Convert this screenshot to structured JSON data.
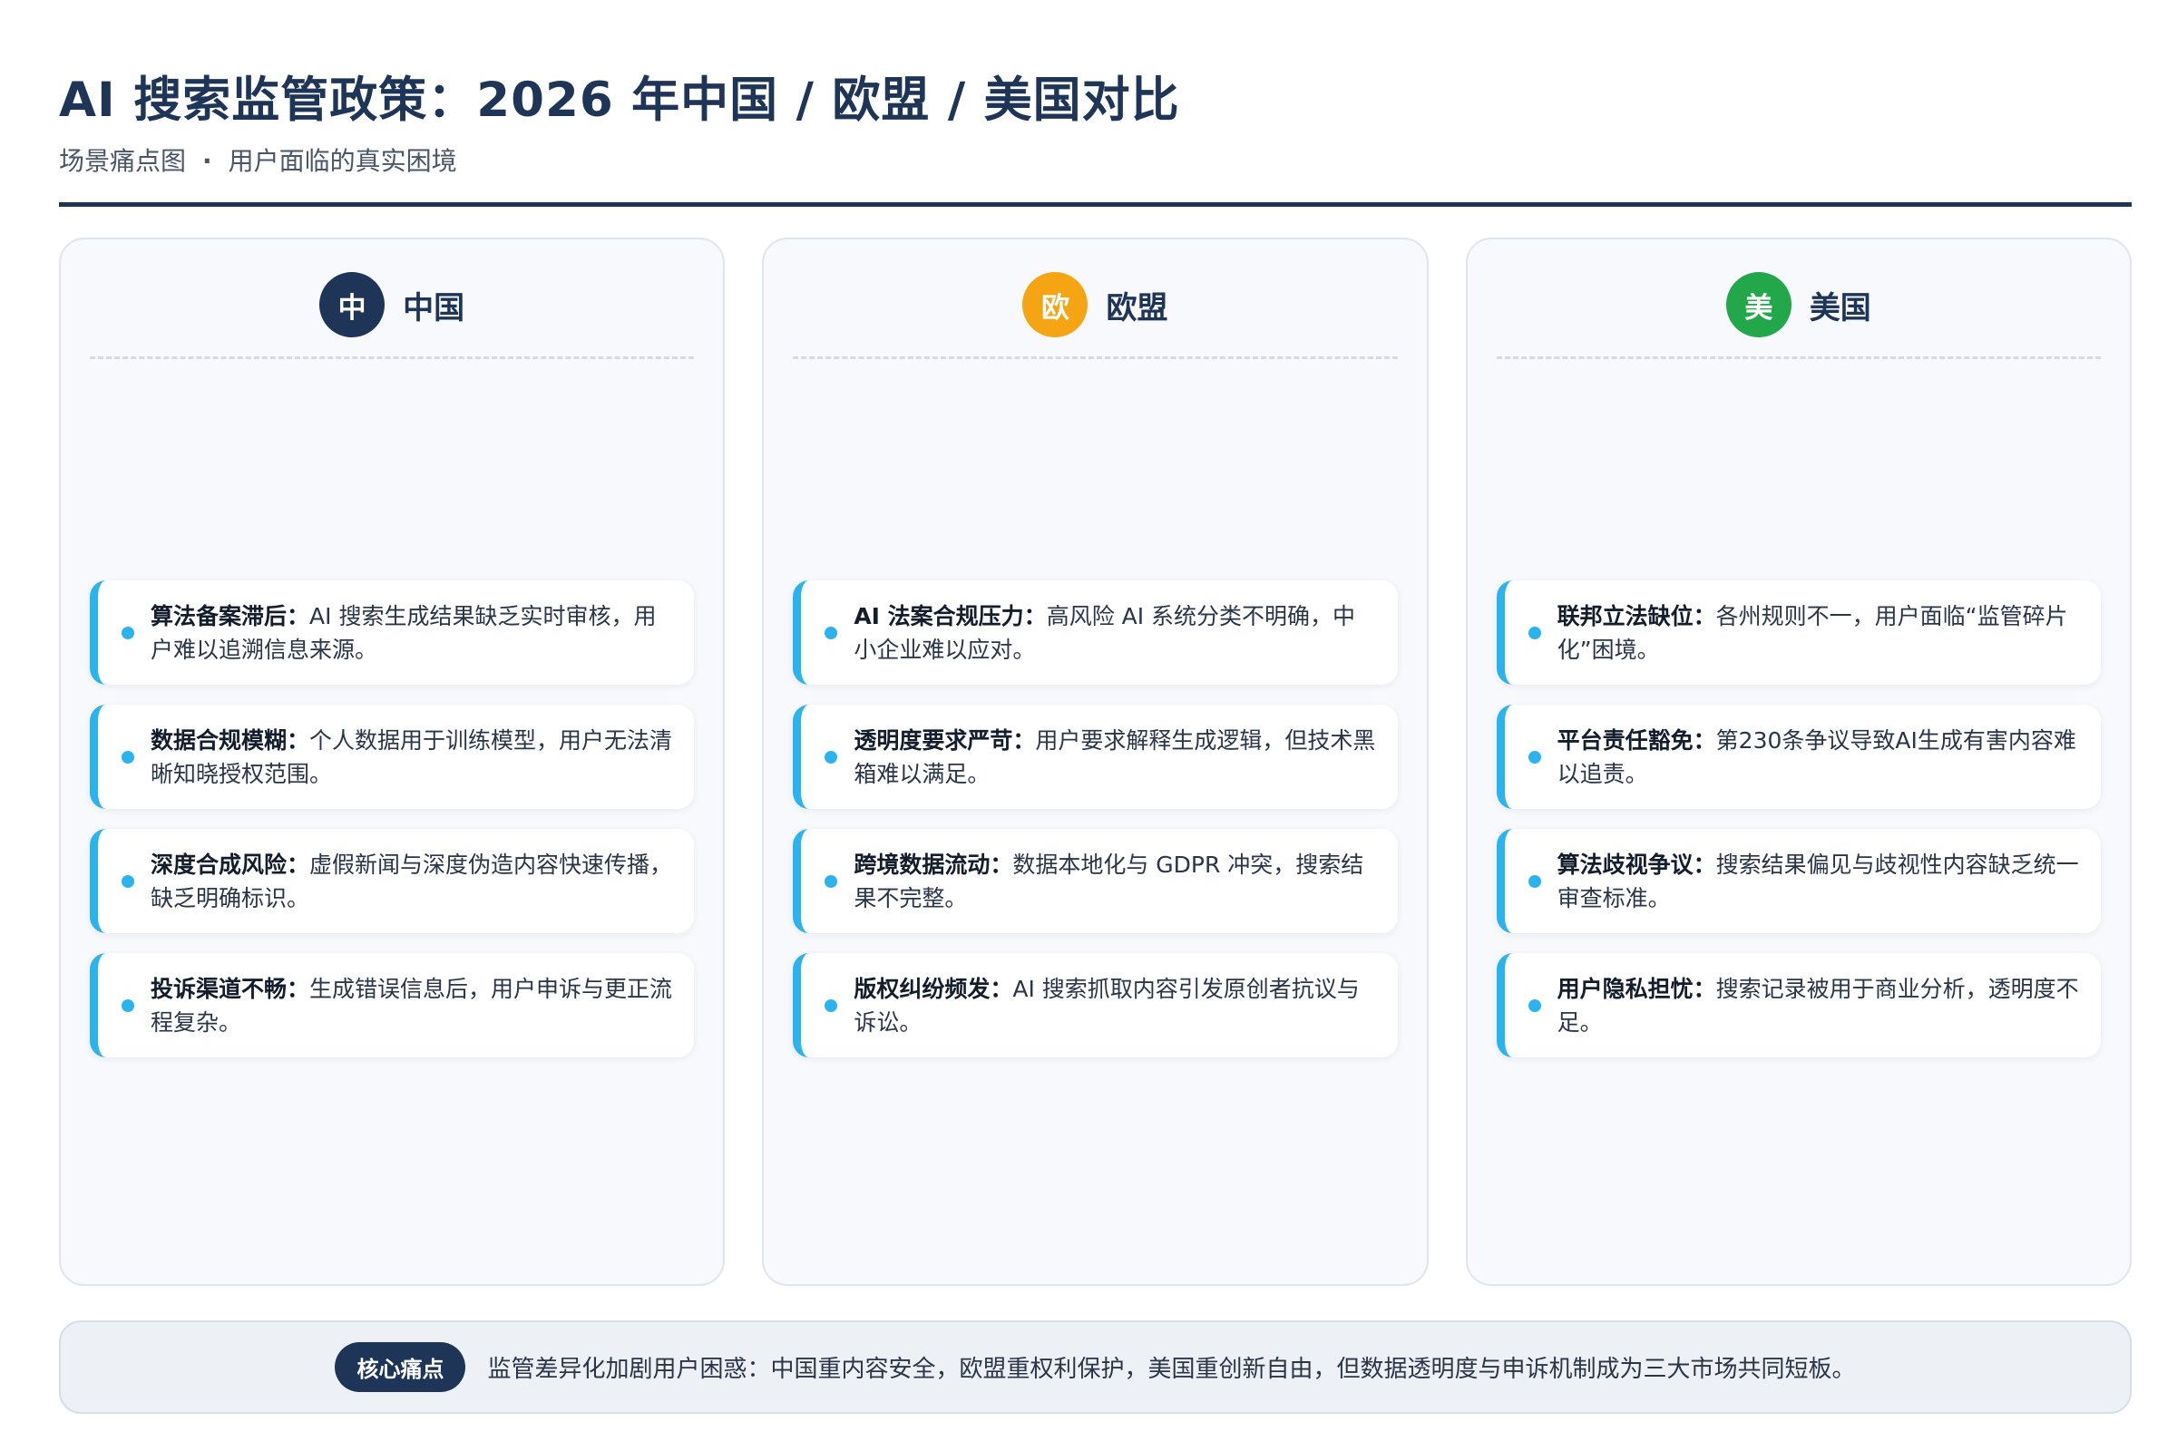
{
  "header": {
    "title": "AI 搜索监管政策：2026 年中国 / 欧盟 / 美国对比",
    "subtitle_left": "场景痛点图",
    "subtitle_sep": "·",
    "subtitle_right": "用户面临的真实困境"
  },
  "colors": {
    "navy": "#1e3557",
    "china_badge": "#1e3557",
    "eu_badge": "#f5a414",
    "us_badge": "#22a84a",
    "accent_bar": "#2bb3ee"
  },
  "columns": [
    {
      "badge": "中",
      "name": "中国",
      "items": [
        {
          "label": "算法备案滞后：",
          "text": "AI 搜索生成结果缺乏实时审核，用户难以追溯信息来源。"
        },
        {
          "label": "数据合规模糊：",
          "text": "个人数据用于训练模型，用户无法清晰知晓授权范围。"
        },
        {
          "label": "深度合成风险：",
          "text": "虚假新闻与深度伪造内容快速传播，缺乏明确标识。"
        },
        {
          "label": "投诉渠道不畅：",
          "text": "生成错误信息后，用户申诉与更正流程复杂。"
        }
      ]
    },
    {
      "badge": "欧",
      "name": "欧盟",
      "items": [
        {
          "label": "AI 法案合规压力：",
          "text": "高风险 AI 系统分类不明确，中小企业难以应对。"
        },
        {
          "label": "透明度要求严苛：",
          "text": "用户要求解释生成逻辑，但技术黑箱难以满足。"
        },
        {
          "label": "跨境数据流动：",
          "text": "数据本地化与 GDPR 冲突，搜索结果不完整。"
        },
        {
          "label": "版权纠纷频发：",
          "text": "AI 搜索抓取内容引发原创者抗议与诉讼。"
        }
      ]
    },
    {
      "badge": "美",
      "name": "美国",
      "items": [
        {
          "label": "联邦立法缺位：",
          "text": "各州规则不一，用户面临“监管碎片化”困境。"
        },
        {
          "label": "平台责任豁免：",
          "text": "第230条争议导致AI生成有害内容难以追责。"
        },
        {
          "label": "算法歧视争议：",
          "text": "搜索结果偏见与歧视性内容缺乏统一审查标准。"
        },
        {
          "label": "用户隐私担忧：",
          "text": "搜索记录被用于商业分析，透明度不足。"
        }
      ]
    }
  ],
  "summary": {
    "tag": "核心痛点",
    "text": "监管差异化加剧用户困惑：中国重内容安全，欧盟重权利保护，美国重创新自由，但数据透明度与申诉机制成为三大市场共同短板。"
  }
}
